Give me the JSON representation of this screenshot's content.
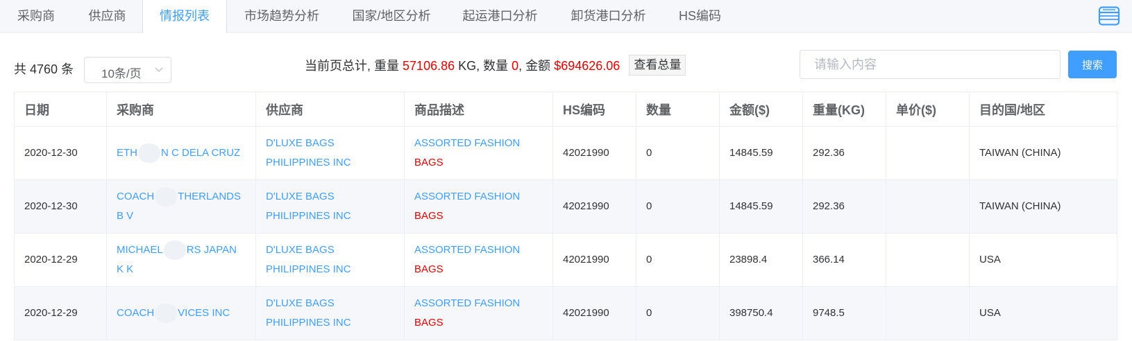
{
  "tabs": [
    {
      "label": "采购商",
      "active": false
    },
    {
      "label": "供应商",
      "active": false
    },
    {
      "label": "情报列表",
      "active": true
    },
    {
      "label": "市场趋势分析",
      "active": false
    },
    {
      "label": "国家/地区分析",
      "active": false
    },
    {
      "label": "起运港口分析",
      "active": false
    },
    {
      "label": "卸货港口分析",
      "active": false
    },
    {
      "label": "HS编码",
      "active": false
    }
  ],
  "toolbar": {
    "total_count": "共 4760 条",
    "page_size": "10条/页",
    "summary": {
      "prefix": "当前页总计, 重量",
      "weight": "57106.86",
      "weight_unit": "KG, 数量",
      "quantity": "0",
      "amount_label": ", 金额",
      "amount": "$694626.06",
      "view_total_label": "查看总量"
    },
    "search_placeholder": "请输入内容",
    "search_button": "搜索"
  },
  "table": {
    "headers": [
      "日期",
      "采购商",
      "供应商",
      "商品描述",
      "HS编码",
      "数量",
      "金额($)",
      "重量(KG)",
      "单价($)",
      "目的国/地区"
    ],
    "rows": [
      {
        "date": "2020-12-30",
        "buyer_a": "ETH",
        "buyer_b": "N C DELA CRUZ",
        "supplier": "D'LUXE BAGS PHILIPPINES INC",
        "desc_plain": "ASSORTED FASHION ",
        "desc_highlight": "BAGS",
        "hs": "42021990",
        "qty": "0",
        "amount": "14845.59",
        "weight": "292.36",
        "unit_price": "",
        "dest": "TAIWAN (CHINA)"
      },
      {
        "date": "2020-12-30",
        "buyer_a": "COACH",
        "buyer_b": "THERLANDS B V",
        "supplier": "D'LUXE BAGS PHILIPPINES INC",
        "desc_plain": "ASSORTED FASHION ",
        "desc_highlight": "BAGS",
        "hs": "42021990",
        "qty": "0",
        "amount": "14845.59",
        "weight": "292.36",
        "unit_price": "",
        "dest": "TAIWAN (CHINA)"
      },
      {
        "date": "2020-12-29",
        "buyer_a": "MICHAEL",
        "buyer_b": "RS JAPAN K K",
        "supplier": "D'LUXE BAGS PHILIPPINES INC",
        "desc_plain": "ASSORTED FASHION ",
        "desc_highlight": "BAGS",
        "hs": "42021990",
        "qty": "0",
        "amount": "23898.4",
        "weight": "366.14",
        "unit_price": "",
        "dest": "USA"
      },
      {
        "date": "2020-12-29",
        "buyer_a": "COACH",
        "buyer_b": "VICES INC",
        "supplier": "D'LUXE BAGS PHILIPPINES INC",
        "desc_plain": "ASSORTED FASHION ",
        "desc_highlight": "BAGS",
        "hs": "42021990",
        "qty": "0",
        "amount": "398750.4",
        "weight": "9748.5",
        "unit_price": "",
        "dest": "USA"
      }
    ]
  },
  "colors": {
    "accent": "#409eff",
    "highlight": "#e00000",
    "border": "#ebeef5",
    "tab_bar_bg": "#f5f7fa"
  },
  "icons": {
    "tab_end": "print-icon",
    "page_size_dropdown": "chevron-down-icon"
  }
}
